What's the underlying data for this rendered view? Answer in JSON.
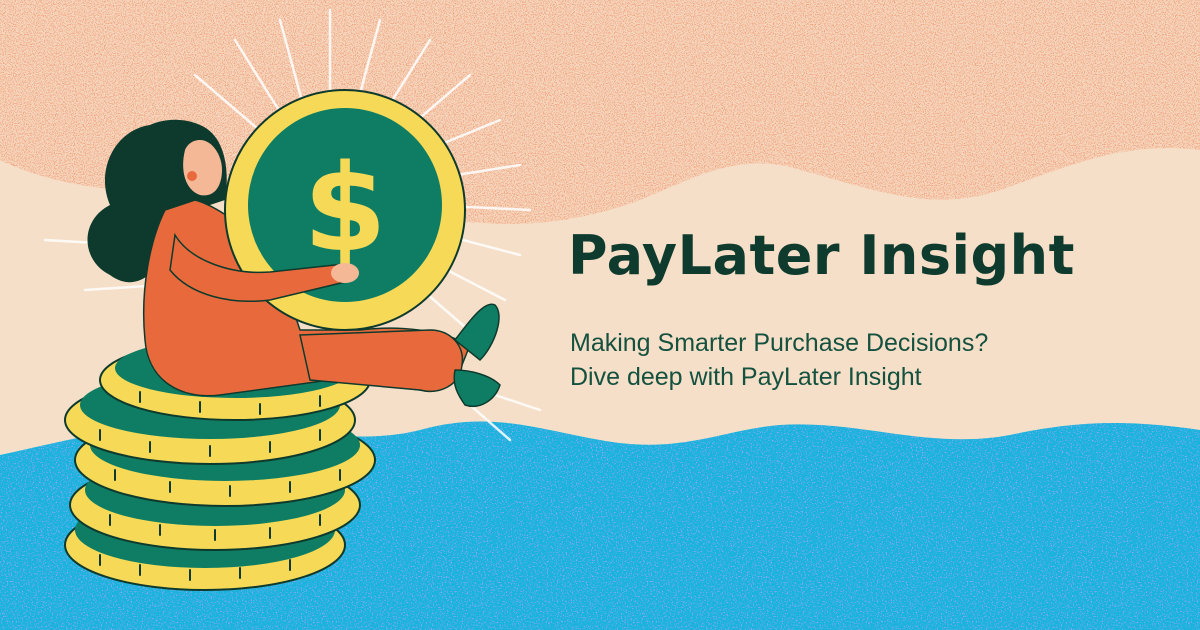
{
  "banner": {
    "title": "PayLater Insight",
    "subtitle_line1": "Making Smarter Purchase Decisions?",
    "subtitle_line2": "Dive deep with PayLater Insight",
    "illustration": {
      "subject": "woman hugging a large dollar coin while sitting on a stack of coins",
      "coin_symbol": "$"
    },
    "colors": {
      "background": "#f6dfc8",
      "speckle": "#e2623a",
      "water": "#1ab3dc",
      "water_speckle": "#7a5cff",
      "coin_gold": "#f5d957",
      "coin_green": "#0e7d63",
      "outfit": "#e86a3c",
      "hair": "#0e3a2d",
      "title": "#0f3b2e"
    }
  }
}
